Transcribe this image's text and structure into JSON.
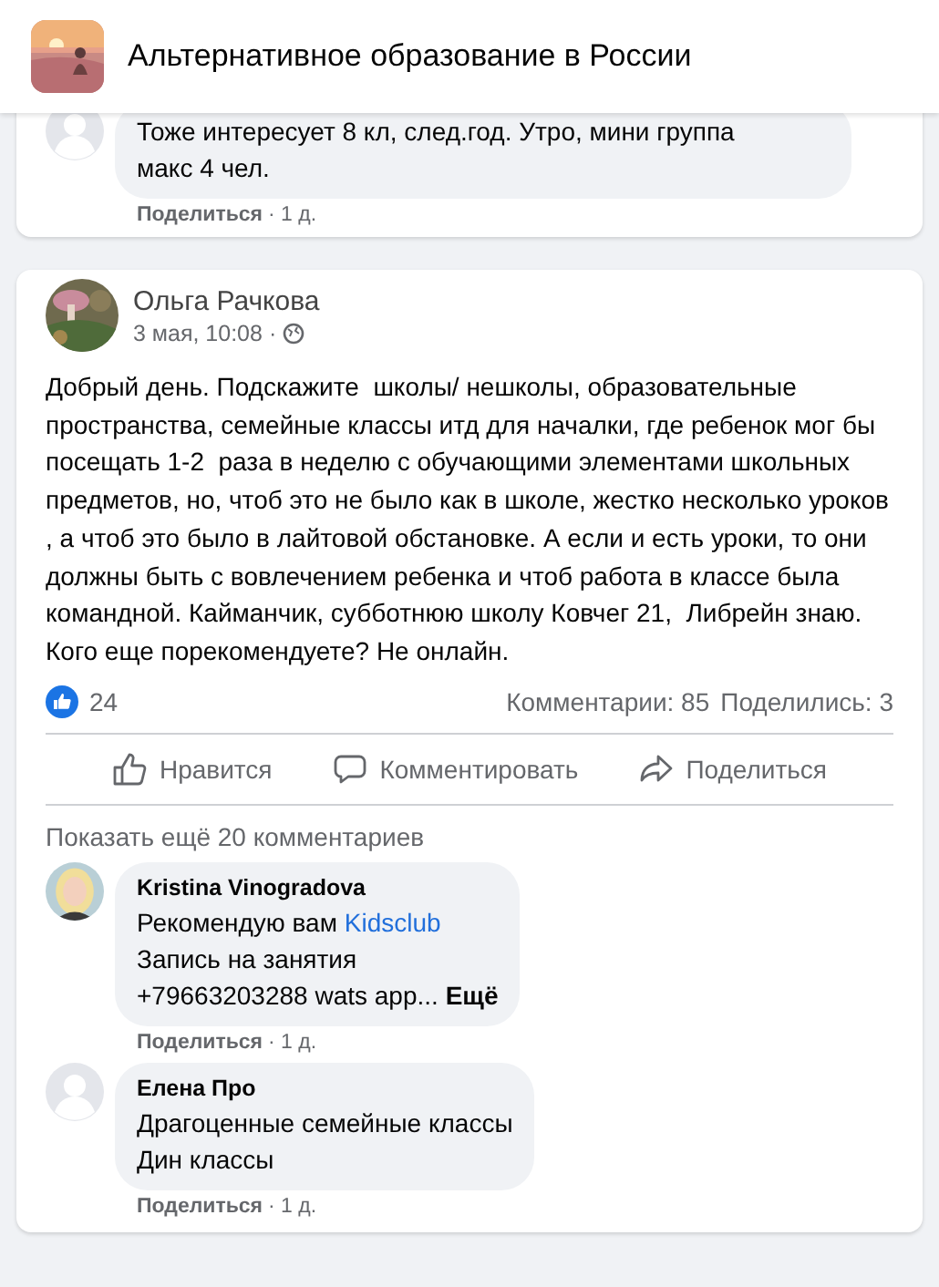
{
  "header": {
    "group_title": "Альтернативное образование в России"
  },
  "previous_comment": {
    "lines": [
      {
        "text": "Тоже интересует 8 кл, след.год. Утро, мини группа"
      },
      {
        "text": "макс 4 чел."
      }
    ],
    "share": "Поделиться",
    "time": "· 1 д."
  },
  "post": {
    "author": "Ольга Рачкова",
    "date": "3 мая, 10:08 ·",
    "body": "Добрый день. Подскажите  школы/ нешколы, образовательные пространства, семейные классы итд для началки, где ребенок мог бы посещать 1-2  раза в неделю с обучающими элементами школьных предметов, но, чтоб это не было как в школе, жестко несколько уроков , а чтоб это было в лайтовой обстановке. А если и есть уроки, то они должны быть с вовлечением ребенка и чтоб работа в классе была командной. Кайманчик, субботнюю школу Ковчег 21,  Либрейн знаю. Кого еще порекомендуете? Не онлайн.",
    "likes": "24",
    "comments": "Комментарии: 85",
    "shares": "Поделились: 3",
    "actions": [
      {
        "kind": "like",
        "label": "Нравится"
      },
      {
        "kind": "comment",
        "label": "Комментировать"
      },
      {
        "kind": "share",
        "label": "Поделиться"
      }
    ],
    "show_more": "Показать ещё 20 комментариев"
  },
  "comments": [
    {
      "author": "Kristina Vinogradova",
      "kind": "picture",
      "lines": [
        {
          "text": "Рекомендую вам",
          "link": "Kidsclub"
        },
        {
          "text": "Запись на занятия"
        },
        {
          "text": "+79663203288 wats app...",
          "more": "Ещё"
        }
      ],
      "share": "Поделиться",
      "time": "· 1 д."
    },
    {
      "author": "Елена Про",
      "kind": "default",
      "lines": [
        {
          "text": "Драгоценные семейные классы"
        },
        {
          "text": "Дин классы"
        }
      ],
      "share": "Поделиться",
      "time": "· 1 д."
    }
  ]
}
